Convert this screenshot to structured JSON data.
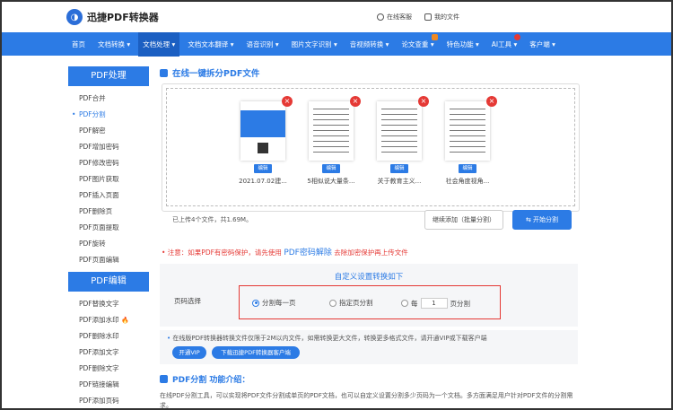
{
  "header": {
    "logo_text": "迅捷PDF转换器",
    "online_consult": "在线客服",
    "my_files": "我的文件"
  },
  "nav": {
    "items": [
      {
        "label": "首页"
      },
      {
        "label": "文档转换 ▾"
      },
      {
        "label": "文档处理 ▾"
      },
      {
        "label": "文档文本翻译 ▾"
      },
      {
        "label": "语音识别 ▾"
      },
      {
        "label": "图片文字识别 ▾"
      },
      {
        "label": "音视频转换 ▾"
      },
      {
        "label": "论文查重 ▾"
      },
      {
        "label": "特色功能 ▾"
      },
      {
        "label": "AI工具 ▾"
      },
      {
        "label": "客户端 ▾"
      }
    ]
  },
  "sidebar": {
    "pdf_process_title": "PDF处理",
    "pdf_process_items": [
      "PDF合并",
      "PDF分割",
      "PDF解密",
      "PDF增加密码",
      "PDF修改密码",
      "PDF图片获取",
      "PDF插入页面",
      "PDF删除页",
      "PDF页面提取",
      "PDF旋转",
      "PDF页面编辑"
    ],
    "pdf_edit_title": "PDF编辑",
    "pdf_edit_items": [
      "PDF替换文字",
      "PDF添加水印",
      "PDF删除水印",
      "PDF添加文字",
      "PDF删除文字",
      "PDF链接编辑",
      "PDF添加页码"
    ],
    "fire_icon": "🔥"
  },
  "main": {
    "section_title": "在线一键拆分PDF文件",
    "files": [
      {
        "name": "2021.07.02建...",
        "edit": "编辑",
        "close": "×"
      },
      {
        "name": "5相似说大量条...",
        "edit": "编辑",
        "close": "×"
      },
      {
        "name": "关于教育主义...",
        "edit": "编辑",
        "close": "×"
      },
      {
        "name": "社会角度视角...",
        "edit": "编辑",
        "close": "×"
      }
    ],
    "upload_stat": "已上传4个文件，共1.69M。",
    "add_button": "继续添加（批量分割）",
    "start_button": "⇆  开始分割",
    "notice_prefix": "•  注意：如果PDF有密码保护，请先使用",
    "notice_link": "PDF密码解除",
    "notice_suffix": "去除加密保护再上传文件",
    "settings_title": "自定义设置转换如下",
    "page_select_label": "页码选择",
    "option_split_each": "分割每一页",
    "option_specified": "指定页分割",
    "option_every": "每",
    "option_every_value": "1",
    "option_every_suffix": "页分割",
    "limit_text": "在线版PDF转换器转换文件仅限于2M以内文件，如需转换更大文件，转换更多格式文件，请开通VIP或下载客户端",
    "vip_button": "开通VIP",
    "download_button": "下载迅捷PDF转换器客户端",
    "intro_title": "PDF分割 功能介绍：",
    "intro_text": "在线PDF分割工具，可以实现将PDF文件分割成单页的PDF文档，也可以自定义设置分割多少页码为一个文档。多方面满足用户针对PDF文件的分割需求。"
  },
  "colors": {
    "brand": "#2c7be5",
    "alert": "#e53935"
  }
}
